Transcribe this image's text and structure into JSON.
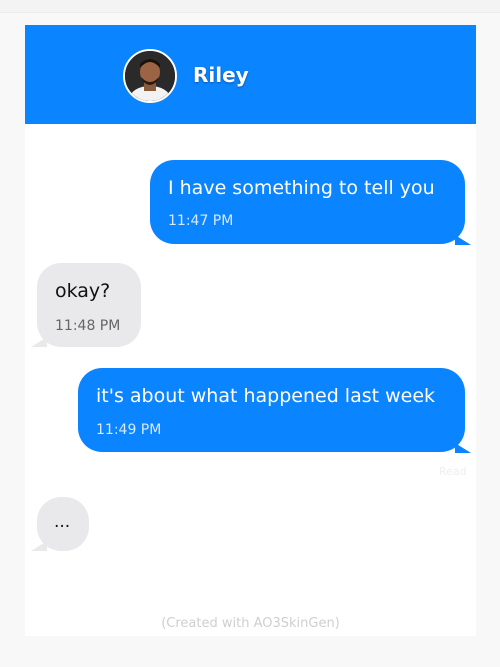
{
  "contact": {
    "name": "Riley",
    "avatar_icon": "person-avatar-icon"
  },
  "messages": [
    {
      "side": "sent",
      "text": "I have something to tell you",
      "time": "11:47 PM"
    },
    {
      "side": "received",
      "text": "okay?",
      "time": "11:48 PM"
    },
    {
      "side": "sent",
      "text": "it's about what happened last week",
      "time": "11:49 PM"
    },
    {
      "side": "received",
      "text": "..."
    }
  ],
  "read_receipt": "Read",
  "footer": "(Created with AO3SkinGen)",
  "colors": {
    "header_background": "#0b84ff",
    "sent_bubble": "#0b84ff",
    "received_bubble": "#e9e9eb"
  }
}
